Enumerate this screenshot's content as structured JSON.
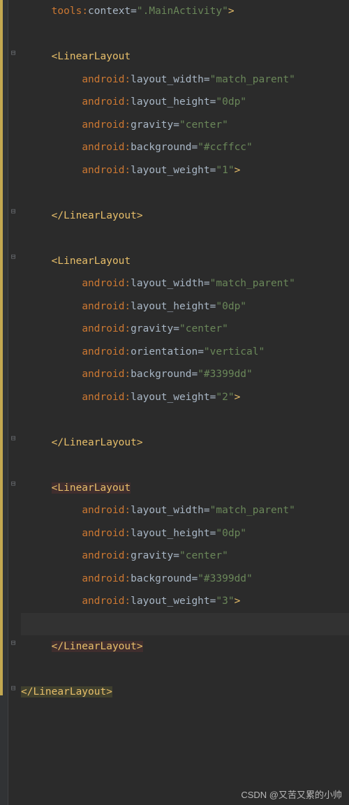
{
  "watermark": "CSDN @又苦又累的小帅",
  "ns_tools": "tools",
  "ns_android": "android",
  "attr_context": "context",
  "attr_width": "layout_width",
  "attr_height": "layout_height",
  "attr_gravity": "gravity",
  "attr_orientation": "orientation",
  "attr_background": "background",
  "attr_weight": "layout_weight",
  "val_main": "\".MainActivity\"",
  "val_match": "\"match_parent\"",
  "val_0dp": "\"0dp\"",
  "val_center": "\"center\"",
  "val_vertical": "\"vertical\"",
  "val_ccffcc": "\"#ccffcc\"",
  "val_3399dd": "\"#3399dd\"",
  "val_w1": "\"1\"",
  "val_w2": "\"2\"",
  "val_w3": "\"3\"",
  "tag_open": "<LinearLayout",
  "tag_close": "</LinearLayout>",
  "bracket_close": ">"
}
